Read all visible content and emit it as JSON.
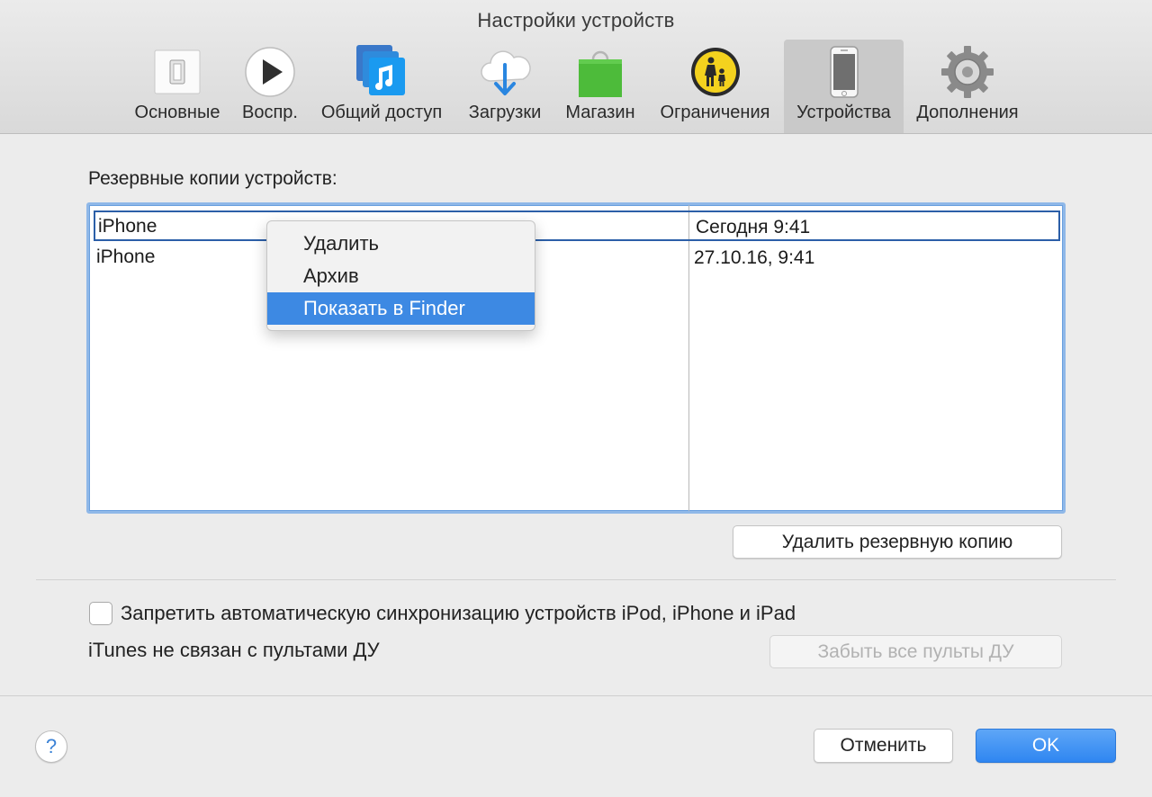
{
  "window": {
    "title": "Настройки устройств"
  },
  "toolbar": {
    "tabs": [
      {
        "label": "Основные",
        "icon": "switch-icon",
        "active": false
      },
      {
        "label": "Воспр.",
        "icon": "play-icon",
        "active": false
      },
      {
        "label": "Общий доступ",
        "icon": "music-library-icon",
        "active": false
      },
      {
        "label": "Загрузки",
        "icon": "cloud-download-icon",
        "active": false
      },
      {
        "label": "Магазин",
        "icon": "shopping-bag-icon",
        "active": false
      },
      {
        "label": "Ограничения",
        "icon": "parental-controls-icon",
        "active": false
      },
      {
        "label": "Устройства",
        "icon": "iphone-icon",
        "active": true
      },
      {
        "label": "Дополнения",
        "icon": "gear-icon",
        "active": false
      }
    ]
  },
  "backups": {
    "label": "Резервные копии устройств:",
    "rows": [
      {
        "name": "iPhone",
        "date": "Сегодня 9:41",
        "selected": true
      },
      {
        "name": "iPhone",
        "date": "27.10.16, 9:41",
        "selected": false
      }
    ],
    "delete_button": "Удалить резервную копию"
  },
  "context_menu": {
    "items": [
      {
        "label": "Удалить",
        "highlighted": false
      },
      {
        "label": "Архив",
        "highlighted": false
      },
      {
        "label": "Показать в Finder",
        "highlighted": true
      }
    ]
  },
  "sync": {
    "prevent_auto_sync_label": "Запретить автоматическую синхронизацию устройств iPod, iPhone и iPad",
    "prevent_auto_sync_checked": false
  },
  "remotes": {
    "status": "iTunes не связан с пультами ДУ",
    "forget_button": "Забыть все пульты ДУ"
  },
  "footer": {
    "help_label": "?",
    "cancel_button": "Отменить",
    "ok_button": "OK"
  },
  "colors": {
    "accent": "#3d89e3",
    "ok_button": "#2f86f1",
    "selection_border": "#2c5fa8"
  }
}
